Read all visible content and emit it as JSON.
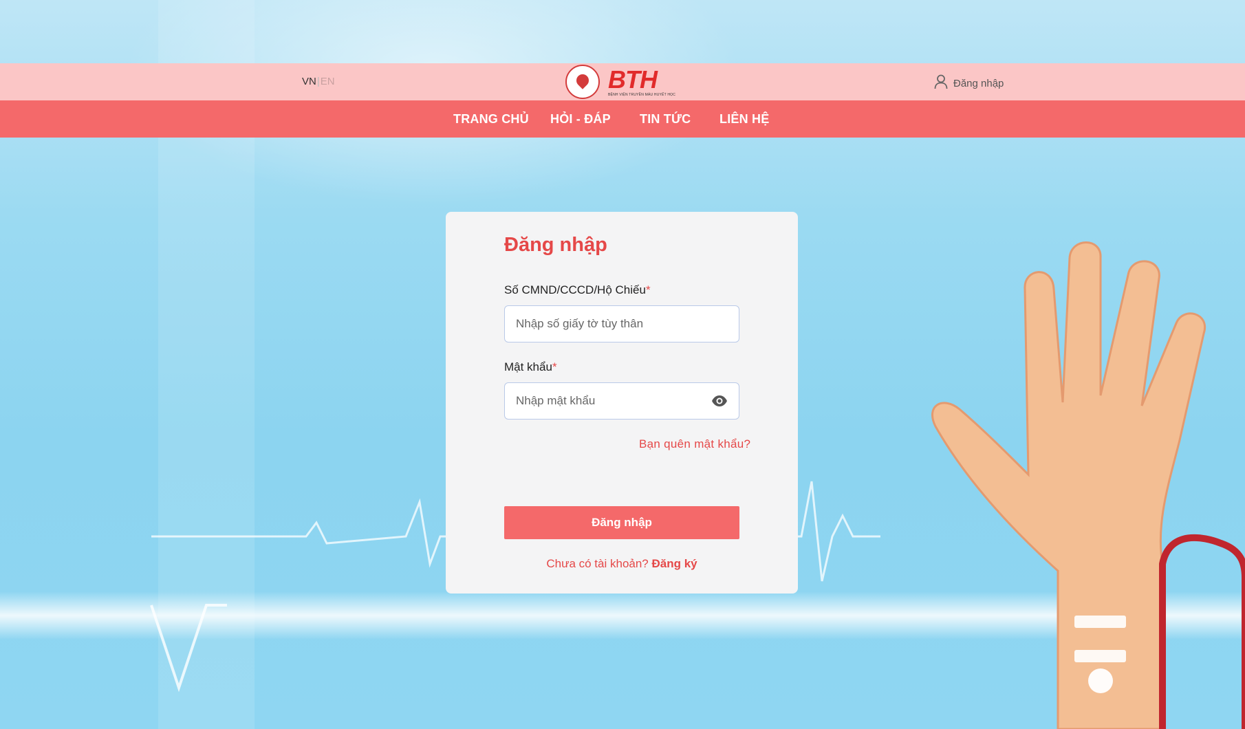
{
  "header": {
    "lang_active": "VN",
    "lang_separator": "|",
    "lang_inactive": "EN",
    "brand_mark": "BTH",
    "brand_sub": "BỆNH VIỆN TRUYỀN MÁU HUYẾT HỌC",
    "login_label": "Đăng nhập"
  },
  "nav": {
    "items": [
      "TRANG CHỦ",
      "HỎI - ĐÁP",
      "TIN TỨC",
      "LIÊN HỆ"
    ]
  },
  "login_form": {
    "title": "Đăng nhập",
    "id_label": "Số CMND/CCCD/Hộ Chiếu",
    "id_placeholder": "Nhập số giấy tờ tùy thân",
    "password_label": "Mật khẩu",
    "password_placeholder": "Nhập mật khẩu",
    "required_mark": "*",
    "forgot_label": "Bạn quên mật khẩu?",
    "submit_label": "Đăng nhập",
    "no_account_text": "Chưa có tài khoản?",
    "register_label": "Đăng ký"
  },
  "colors": {
    "topbar": "#fbc6c6",
    "navbar": "#f4696a",
    "accent": "#e54848"
  },
  "icons": {
    "user": "user-icon",
    "eye": "eye-icon"
  }
}
